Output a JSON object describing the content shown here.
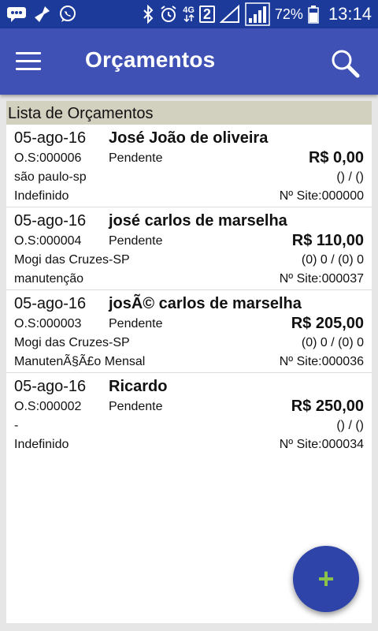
{
  "status_bar": {
    "icons_left": [
      "chat-bubble-icon",
      "broom-icon",
      "whatsapp-icon"
    ],
    "icons_right": [
      "bluetooth-icon",
      "alarm-icon",
      "network-4g-icon",
      "sim2-icon",
      "signal-icon",
      "signal-full-icon",
      "battery-icon"
    ],
    "network": "4G",
    "sim": "2",
    "battery": "72%",
    "time": "13:14"
  },
  "appbar": {
    "title": "Orçamentos",
    "menu_icon": "hamburger-menu-icon",
    "search_icon": "search-icon"
  },
  "list": {
    "header": "Lista de Orçamentos",
    "items": [
      {
        "date": "05-ago-16",
        "name": "José João de oliveira",
        "os": "O.S:000006",
        "status": "Pendente",
        "price": "R$ 0,00",
        "city": "são paulo-sp",
        "phone": "() / ()",
        "service": "Indefinido",
        "site": "Nº Site:000000"
      },
      {
        "date": "05-ago-16",
        "name": "josé carlos de marselha",
        "os": "O.S:000004",
        "status": "Pendente",
        "price": "R$ 110,00",
        "city": "Mogi das Cruzes-SP",
        "phone": "(0) 0 / (0) 0",
        "service": "manutenção",
        "site": "Nº Site:000037"
      },
      {
        "date": "05-ago-16",
        "name": "josÃ© carlos de marselha",
        "os": "O.S:000003",
        "status": "Pendente",
        "price": "R$ 205,00",
        "city": "Mogi das Cruzes-SP",
        "phone": "(0) 0 / (0) 0",
        "service": "ManutenÃ§Ã£o Mensal",
        "site": "Nº Site:000036"
      },
      {
        "date": "05-ago-16",
        "name": "Ricardo",
        "os": "O.S:000002",
        "status": "Pendente",
        "price": "R$ 250,00",
        "city": "-",
        "phone": "() / ()",
        "service": "Indefinido",
        "site": "Nº Site:000034"
      }
    ]
  },
  "fab": {
    "label": "+",
    "icon": "plus-icon"
  },
  "colors": {
    "status_bar": "#1b3a9a",
    "app_bar": "#3f51b5",
    "list_header": "#d2d0be",
    "fab": "#2e44a8",
    "fab_plus": "#8bc34a"
  }
}
